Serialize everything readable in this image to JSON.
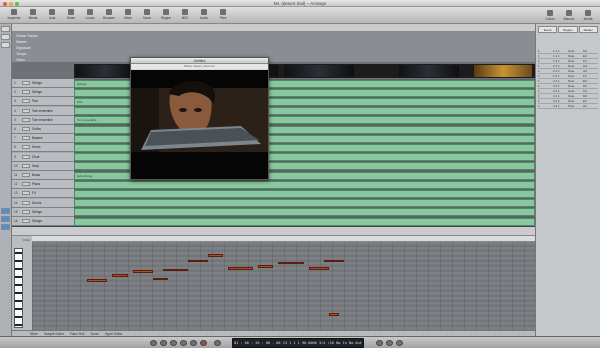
{
  "window": {
    "title": "Mr. (desert trial) – Arrange"
  },
  "toolbar": {
    "buttons": [
      {
        "label": "Inspector",
        "icon": "inspector-icon"
      },
      {
        "label": "Media",
        "icon": "media-icon"
      },
      {
        "label": "Lists",
        "icon": "lists-icon"
      },
      {
        "label": "Notes",
        "icon": "notes-icon"
      },
      {
        "label": "Loops",
        "icon": "loops-icon"
      },
      {
        "label": "Browser",
        "icon": "browser-icon"
      },
      {
        "label": "Mixer",
        "icon": "mixer-icon"
      },
      {
        "label": "Score",
        "icon": "score-icon"
      },
      {
        "label": "Region",
        "icon": "region-icon"
      },
      {
        "label": "MIDI",
        "icon": "midi-icon"
      },
      {
        "label": "Audio",
        "icon": "audio-icon"
      },
      {
        "label": "Files",
        "icon": "files-icon"
      }
    ],
    "right_buttons": [
      "Colors",
      "Bounce",
      "Media"
    ]
  },
  "arrange": {
    "global_tracks": [
      "Global Tracks",
      "Marker",
      "Signature",
      "Tempo",
      "Video"
    ],
    "tracks": [
      {
        "num": "1",
        "name": "Strings"
      },
      {
        "num": "2",
        "name": "Strings"
      },
      {
        "num": "3",
        "name": "Pizz"
      },
      {
        "num": "4",
        "name": "Tom ensemble"
      },
      {
        "num": "5",
        "name": "Tom ensemble"
      },
      {
        "num": "6",
        "name": "Cellos"
      },
      {
        "num": "7",
        "name": "Basses"
      },
      {
        "num": "8",
        "name": "Horns"
      },
      {
        "num": "9",
        "name": "Choir"
      },
      {
        "num": "10",
        "name": "Harp"
      },
      {
        "num": "11",
        "name": "Brass"
      },
      {
        "num": "12",
        "name": "Piano"
      },
      {
        "num": "13",
        "name": "FX"
      },
      {
        "num": "14",
        "name": "Drums"
      },
      {
        "num": "15",
        "name": "Strings"
      },
      {
        "num": "16",
        "name": "Strings"
      }
    ],
    "region_names": [
      "Strings",
      "",
      "Pizz",
      "",
      "Tom ensemble",
      "",
      "",
      "",
      "",
      "",
      "solo strings",
      "",
      "",
      "",
      "",
      ""
    ]
  },
  "movie": {
    "title": "Untitled",
    "subtitle": "Movie: desert_trial.mov"
  },
  "browser": {
    "tabs": [
      "Event",
      "Region",
      "Marker"
    ],
    "rows": [
      [
        "1",
        "1 1 1",
        "Note",
        "D3"
      ],
      [
        "1",
        "1 2 1",
        "Note",
        "E3"
      ],
      [
        "1",
        "1 3 1",
        "Note",
        "F3"
      ],
      [
        "1",
        "2 1 1",
        "Note",
        "G3"
      ],
      [
        "1",
        "2 2 1",
        "Note",
        "A3"
      ],
      [
        "1",
        "2 3 1",
        "Note",
        "F3"
      ],
      [
        "1",
        "3 1 1",
        "Note",
        "E3"
      ],
      [
        "1",
        "3 2 1",
        "Note",
        "D3"
      ],
      [
        "1",
        "3 3 1",
        "Note",
        "C3"
      ],
      [
        "1",
        "4 1 1",
        "Note",
        "D3"
      ],
      [
        "1",
        "4 2 1",
        "Note",
        "E3"
      ],
      [
        "1",
        "4 3 1",
        "Note",
        "A2"
      ]
    ]
  },
  "editor": {
    "tabs": [
      "Mixer",
      "Sample Editor",
      "Piano Roll",
      "Score",
      "Hyper Editor"
    ],
    "track_label": "Choir",
    "notes": [
      {
        "start": 0.11,
        "len": 0.04,
        "pitch": 0.42
      },
      {
        "start": 0.16,
        "len": 0.03,
        "pitch": 0.36
      },
      {
        "start": 0.2,
        "len": 0.04,
        "pitch": 0.32
      },
      {
        "start": 0.24,
        "len": 0.03,
        "pitch": 0.4
      },
      {
        "start": 0.26,
        "len": 0.05,
        "pitch": 0.3
      },
      {
        "start": 0.31,
        "len": 0.04,
        "pitch": 0.2
      },
      {
        "start": 0.35,
        "len": 0.03,
        "pitch": 0.14
      },
      {
        "start": 0.39,
        "len": 0.05,
        "pitch": 0.28
      },
      {
        "start": 0.45,
        "len": 0.03,
        "pitch": 0.26
      },
      {
        "start": 0.49,
        "len": 0.05,
        "pitch": 0.22
      },
      {
        "start": 0.55,
        "len": 0.04,
        "pitch": 0.28
      },
      {
        "start": 0.58,
        "len": 0.04,
        "pitch": 0.2
      },
      {
        "start": 0.59,
        "len": 0.02,
        "pitch": 0.8
      }
    ]
  },
  "transport": {
    "position": "01 : 00 : 26 : 00 . 00",
    "bars": "13 1 1 1",
    "tempo": "90.0000",
    "signature": "3/4",
    "division": "/16",
    "in": "No In",
    "out": "No Out"
  },
  "colors": {
    "region": "#8ac79e",
    "note": "#b24a22",
    "accent": "#4b93d6"
  }
}
